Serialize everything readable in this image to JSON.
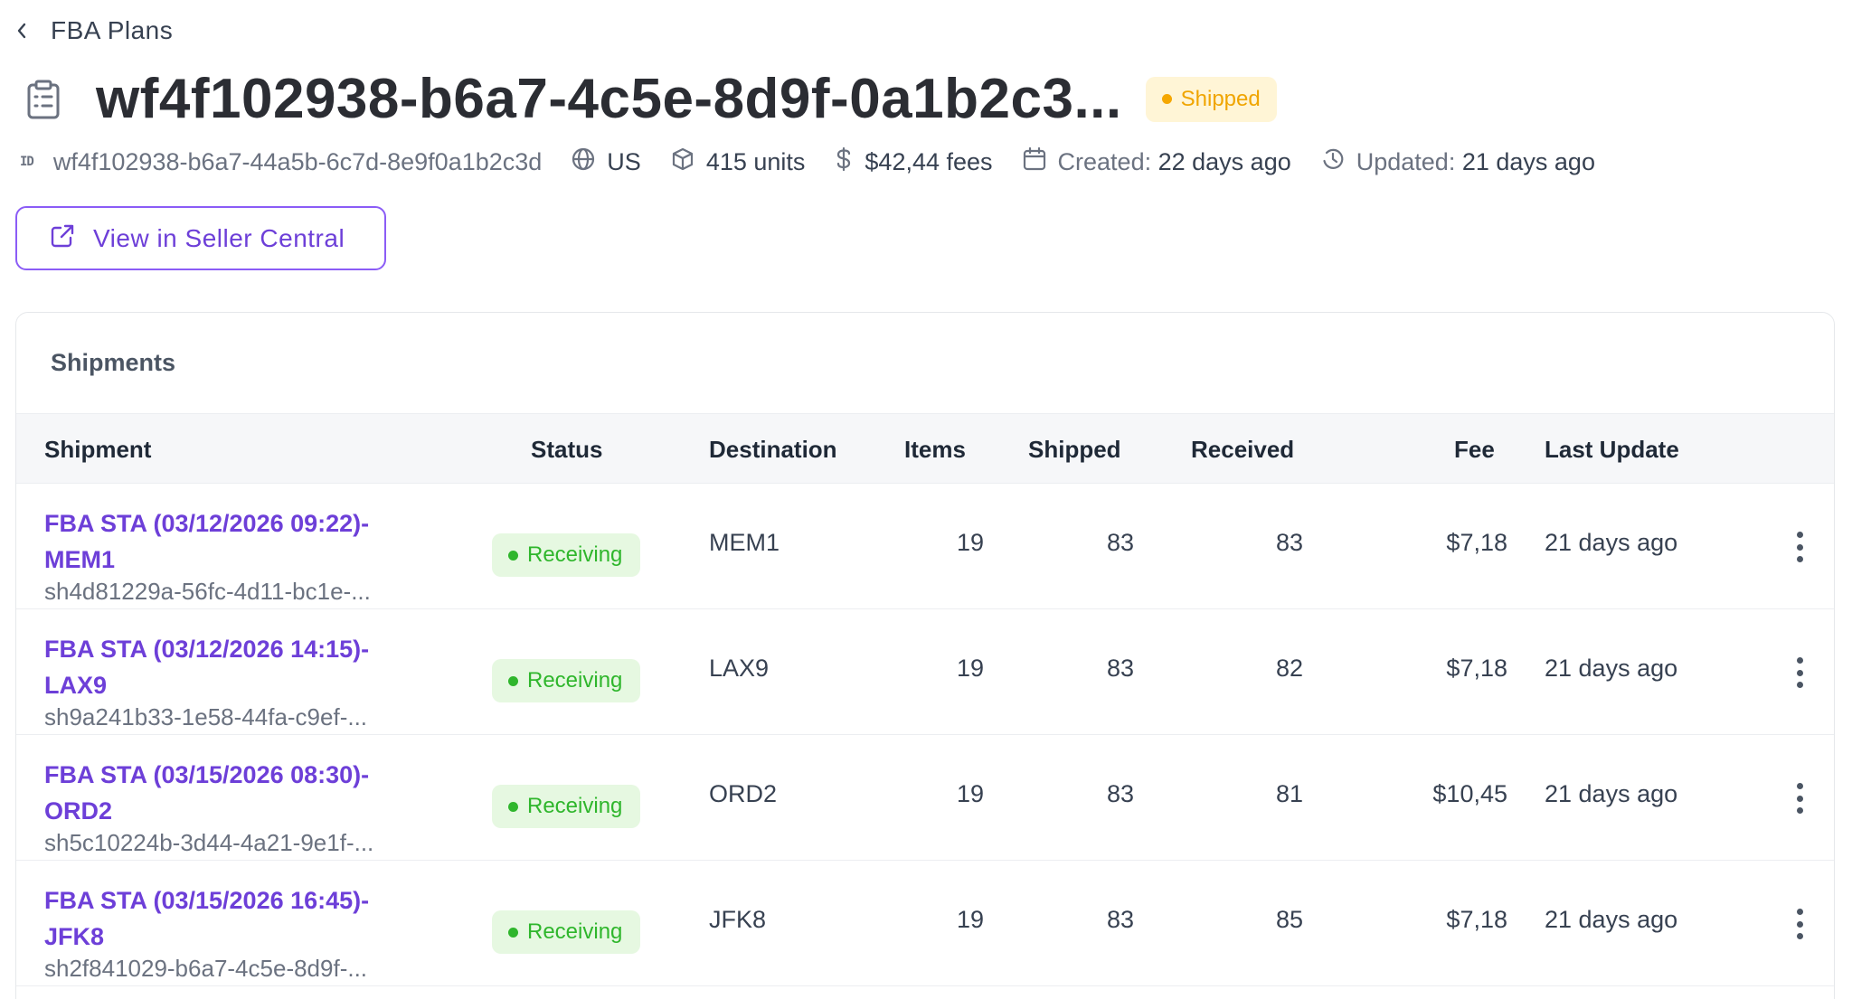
{
  "breadcrumb": {
    "label": "FBA Plans",
    "back_icon": "chevron-left-icon"
  },
  "header": {
    "title": "wf4f102938-b6a7-4c5e-8d9f-0a1b2c3...",
    "status": "Shipped",
    "status_color": "#f5a700"
  },
  "meta": {
    "id_badge": "ID",
    "id": "wf4f102938-b6a7-44a5b-6c7d-8e9f0a1b2c3d",
    "country": "US",
    "units": "415 units",
    "fees": "$42,44 fees",
    "created_label": "Created:",
    "created_value": "22 days ago",
    "updated_label": "Updated:",
    "updated_value": "21 days ago"
  },
  "actions": {
    "seller_central_label": "View in Seller Central"
  },
  "shipments": {
    "title": "Shipments",
    "columns": {
      "shipment": "Shipment",
      "status": "Status",
      "destination": "Destination",
      "items": "Items",
      "shipped": "Shipped",
      "received": "Received",
      "fee": "Fee",
      "last_update": "Last Update"
    },
    "rows": [
      {
        "name_line1": "FBA STA (03/12/2026 09:22)-",
        "name_line2": "MEM1",
        "id": "sh4d81229a-56fc-4d11-bc1e-...",
        "status": "Receiving",
        "destination": "MEM1",
        "items": "19",
        "shipped": "83",
        "received": "83",
        "fee": "$7,18",
        "last_update": "21 days ago"
      },
      {
        "name_line1": "FBA STA (03/12/2026 14:15)-",
        "name_line2": "LAX9",
        "id": "sh9a241b33-1e58-44fa-c9ef-...",
        "status": "Receiving",
        "destination": "LAX9",
        "items": "19",
        "shipped": "83",
        "received": "82",
        "fee": "$7,18",
        "last_update": "21 days ago"
      },
      {
        "name_line1": "FBA STA (03/15/2026 08:30)-",
        "name_line2": "ORD2",
        "id": "sh5c10224b-3d44-4a21-9e1f-...",
        "status": "Receiving",
        "destination": "ORD2",
        "items": "19",
        "shipped": "83",
        "received": "81",
        "fee": "$10,45",
        "last_update": "21 days ago"
      },
      {
        "name_line1": "FBA STA (03/15/2026 16:45)-",
        "name_line2": "JFK8",
        "id": "sh2f841029-b6a7-4c5e-8d9f-...",
        "status": "Receiving",
        "destination": "JFK8",
        "items": "19",
        "shipped": "83",
        "received": "85",
        "fee": "$7,18",
        "last_update": "21 days ago"
      }
    ]
  },
  "colors": {
    "accent": "#6d3fd8",
    "receiving": "#2fb62c",
    "shipped": "#f5a700"
  }
}
